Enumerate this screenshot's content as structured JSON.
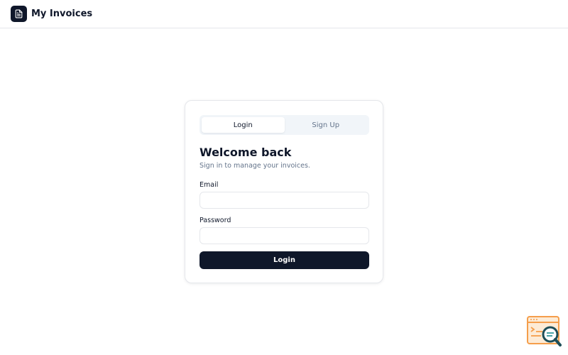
{
  "header": {
    "logo_icon": "document-icon",
    "title": "My Invoices"
  },
  "auth_card": {
    "tabs": [
      {
        "label": "Login",
        "active": true
      },
      {
        "label": "Sign Up",
        "active": false
      }
    ],
    "heading": "Welcome back",
    "subheading": "Sign in to manage your invoices.",
    "email": {
      "label": "Email",
      "value": "",
      "placeholder": ""
    },
    "password": {
      "label": "Password",
      "value": "",
      "placeholder": ""
    },
    "submit_label": "Login"
  },
  "corner_widget": {
    "icon": "search-window-icon"
  },
  "colors": {
    "primary": "#0f172a",
    "muted_text": "#64748b",
    "border": "#e5e7eb",
    "tab_bg": "#f1f5f9",
    "widget_orange": "#f59e4b",
    "widget_teal": "#1e4e58"
  }
}
